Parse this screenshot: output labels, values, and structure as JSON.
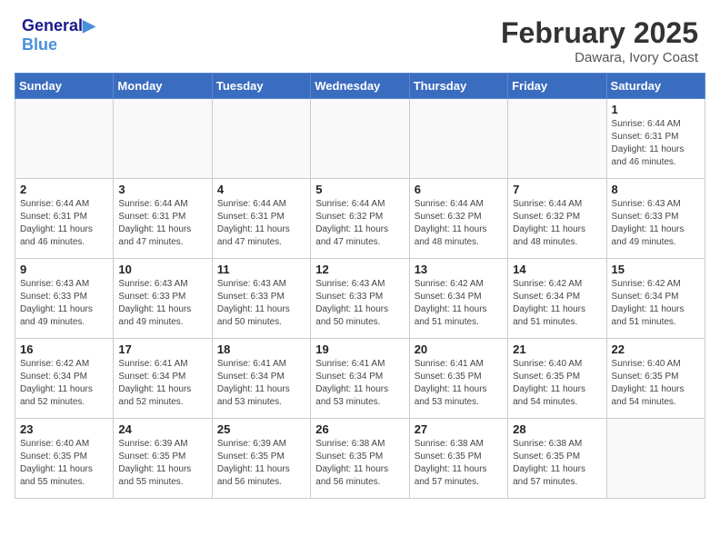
{
  "header": {
    "logo_line1": "General",
    "logo_line2": "Blue",
    "month_year": "February 2025",
    "location": "Dawara, Ivory Coast"
  },
  "days_of_week": [
    "Sunday",
    "Monday",
    "Tuesday",
    "Wednesday",
    "Thursday",
    "Friday",
    "Saturday"
  ],
  "weeks": [
    [
      {
        "day": "",
        "info": ""
      },
      {
        "day": "",
        "info": ""
      },
      {
        "day": "",
        "info": ""
      },
      {
        "day": "",
        "info": ""
      },
      {
        "day": "",
        "info": ""
      },
      {
        "day": "",
        "info": ""
      },
      {
        "day": "1",
        "info": "Sunrise: 6:44 AM\nSunset: 6:31 PM\nDaylight: 11 hours and 46 minutes."
      }
    ],
    [
      {
        "day": "2",
        "info": "Sunrise: 6:44 AM\nSunset: 6:31 PM\nDaylight: 11 hours and 46 minutes."
      },
      {
        "day": "3",
        "info": "Sunrise: 6:44 AM\nSunset: 6:31 PM\nDaylight: 11 hours and 47 minutes."
      },
      {
        "day": "4",
        "info": "Sunrise: 6:44 AM\nSunset: 6:31 PM\nDaylight: 11 hours and 47 minutes."
      },
      {
        "day": "5",
        "info": "Sunrise: 6:44 AM\nSunset: 6:32 PM\nDaylight: 11 hours and 47 minutes."
      },
      {
        "day": "6",
        "info": "Sunrise: 6:44 AM\nSunset: 6:32 PM\nDaylight: 11 hours and 48 minutes."
      },
      {
        "day": "7",
        "info": "Sunrise: 6:44 AM\nSunset: 6:32 PM\nDaylight: 11 hours and 48 minutes."
      },
      {
        "day": "8",
        "info": "Sunrise: 6:43 AM\nSunset: 6:33 PM\nDaylight: 11 hours and 49 minutes."
      }
    ],
    [
      {
        "day": "9",
        "info": "Sunrise: 6:43 AM\nSunset: 6:33 PM\nDaylight: 11 hours and 49 minutes."
      },
      {
        "day": "10",
        "info": "Sunrise: 6:43 AM\nSunset: 6:33 PM\nDaylight: 11 hours and 49 minutes."
      },
      {
        "day": "11",
        "info": "Sunrise: 6:43 AM\nSunset: 6:33 PM\nDaylight: 11 hours and 50 minutes."
      },
      {
        "day": "12",
        "info": "Sunrise: 6:43 AM\nSunset: 6:33 PM\nDaylight: 11 hours and 50 minutes."
      },
      {
        "day": "13",
        "info": "Sunrise: 6:42 AM\nSunset: 6:34 PM\nDaylight: 11 hours and 51 minutes."
      },
      {
        "day": "14",
        "info": "Sunrise: 6:42 AM\nSunset: 6:34 PM\nDaylight: 11 hours and 51 minutes."
      },
      {
        "day": "15",
        "info": "Sunrise: 6:42 AM\nSunset: 6:34 PM\nDaylight: 11 hours and 51 minutes."
      }
    ],
    [
      {
        "day": "16",
        "info": "Sunrise: 6:42 AM\nSunset: 6:34 PM\nDaylight: 11 hours and 52 minutes."
      },
      {
        "day": "17",
        "info": "Sunrise: 6:41 AM\nSunset: 6:34 PM\nDaylight: 11 hours and 52 minutes."
      },
      {
        "day": "18",
        "info": "Sunrise: 6:41 AM\nSunset: 6:34 PM\nDaylight: 11 hours and 53 minutes."
      },
      {
        "day": "19",
        "info": "Sunrise: 6:41 AM\nSunset: 6:34 PM\nDaylight: 11 hours and 53 minutes."
      },
      {
        "day": "20",
        "info": "Sunrise: 6:41 AM\nSunset: 6:35 PM\nDaylight: 11 hours and 53 minutes."
      },
      {
        "day": "21",
        "info": "Sunrise: 6:40 AM\nSunset: 6:35 PM\nDaylight: 11 hours and 54 minutes."
      },
      {
        "day": "22",
        "info": "Sunrise: 6:40 AM\nSunset: 6:35 PM\nDaylight: 11 hours and 54 minutes."
      }
    ],
    [
      {
        "day": "23",
        "info": "Sunrise: 6:40 AM\nSunset: 6:35 PM\nDaylight: 11 hours and 55 minutes."
      },
      {
        "day": "24",
        "info": "Sunrise: 6:39 AM\nSunset: 6:35 PM\nDaylight: 11 hours and 55 minutes."
      },
      {
        "day": "25",
        "info": "Sunrise: 6:39 AM\nSunset: 6:35 PM\nDaylight: 11 hours and 56 minutes."
      },
      {
        "day": "26",
        "info": "Sunrise: 6:38 AM\nSunset: 6:35 PM\nDaylight: 11 hours and 56 minutes."
      },
      {
        "day": "27",
        "info": "Sunrise: 6:38 AM\nSunset: 6:35 PM\nDaylight: 11 hours and 57 minutes."
      },
      {
        "day": "28",
        "info": "Sunrise: 6:38 AM\nSunset: 6:35 PM\nDaylight: 11 hours and 57 minutes."
      },
      {
        "day": "",
        "info": ""
      }
    ]
  ]
}
